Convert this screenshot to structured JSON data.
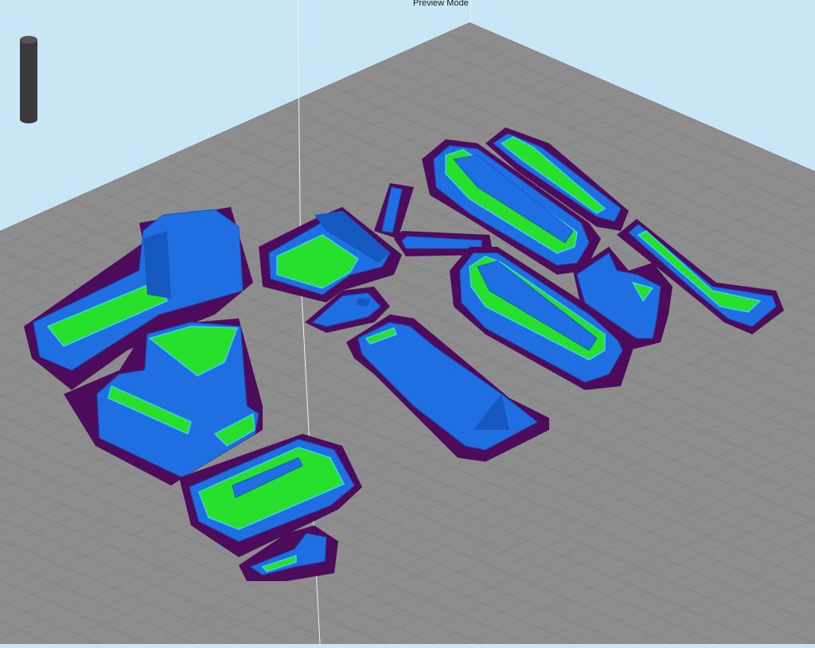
{
  "viewport": {
    "mode_label": "Preview Mode"
  },
  "colors": {
    "background": "#c9e6f7",
    "build_plate": "#8c8c8c",
    "skirt": "#4d0b5c",
    "wall": "#1f6fe3",
    "infill": "#27e02b",
    "outline": "#3fd3e8"
  }
}
